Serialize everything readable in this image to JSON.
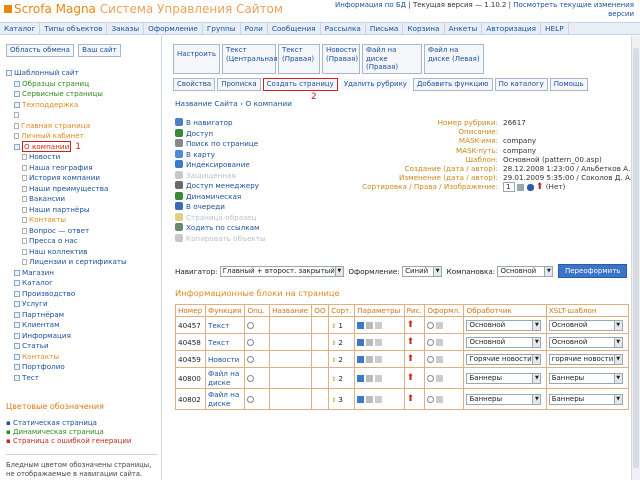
{
  "header": {
    "logo_main": "Scrofa Magna",
    "logo_sub": "Система Управления Сайтом",
    "info_link": "Информация по БД",
    "version_text": "| Текущая версия — 1.10.2 |",
    "changes_link": "Посмотреть текущие изменения версии"
  },
  "topmenu": [
    "Каталог",
    "Типы объектов",
    "Заказы",
    "Оформление",
    "Группы",
    "Роли",
    "Сообщения",
    "Рассылка",
    "Письма",
    "Корзина",
    "Анкеты",
    "Авторизация",
    "HELP"
  ],
  "left": {
    "buttons": [
      "Область обмена",
      "Ваш сайт"
    ],
    "tree": [
      {
        "label": "Шаблонный сайт",
        "color": "dark",
        "indent": 0,
        "icon": "folder"
      },
      {
        "label": "Образцы страниц",
        "color": "green",
        "indent": 1,
        "icon": "folder"
      },
      {
        "label": "Сервисные страницы",
        "color": "green",
        "indent": 1,
        "icon": "folder"
      },
      {
        "label": "Техподдержка",
        "color": "orange",
        "indent": 1,
        "icon": "folder"
      },
      {
        "label": "",
        "color": "gray",
        "indent": 1,
        "icon": "page"
      },
      {
        "label": "Главная страница",
        "color": "orange",
        "indent": 1,
        "icon": "page"
      },
      {
        "label": "Личный кабинет",
        "color": "orange",
        "indent": 1,
        "icon": "page"
      },
      {
        "label": "О компании",
        "color": "red",
        "indent": 1,
        "icon": "folder",
        "selected": true
      },
      {
        "label": "Новости",
        "color": "dark",
        "indent": 2,
        "icon": "page"
      },
      {
        "label": "Наша география",
        "color": "dark",
        "indent": 2,
        "icon": "page"
      },
      {
        "label": "История компании",
        "color": "dark",
        "indent": 2,
        "icon": "page"
      },
      {
        "label": "Наши преимущества",
        "color": "dark",
        "indent": 2,
        "icon": "page"
      },
      {
        "label": "Вакансии",
        "color": "dark",
        "indent": 2,
        "icon": "page"
      },
      {
        "label": "Наши партнёры",
        "color": "dark",
        "indent": 2,
        "icon": "page"
      },
      {
        "label": "Контакты",
        "color": "orange",
        "indent": 2,
        "icon": "page"
      },
      {
        "label": "Вопрос — ответ",
        "color": "dark",
        "indent": 2,
        "icon": "page"
      },
      {
        "label": "Пресса о нас",
        "color": "dark",
        "indent": 2,
        "icon": "page"
      },
      {
        "label": "Наш коллектив",
        "color": "dark",
        "indent": 2,
        "icon": "page"
      },
      {
        "label": "Лицензии и сертификаты",
        "color": "dark",
        "indent": 2,
        "icon": "page"
      },
      {
        "label": "",
        "color": "dark",
        "indent": 1,
        "icon": "none"
      },
      {
        "label": "Магазин",
        "color": "dark",
        "indent": 1,
        "icon": "folder"
      },
      {
        "label": "Каталог",
        "color": "dark",
        "indent": 1,
        "icon": "folder"
      },
      {
        "label": "Производство",
        "color": "dark",
        "indent": 1,
        "icon": "folder"
      },
      {
        "label": "Услуги",
        "color": "dark",
        "indent": 1,
        "icon": "folder"
      },
      {
        "label": "Партнёрам",
        "color": "dark",
        "indent": 1,
        "icon": "folder"
      },
      {
        "label": "Клиентам",
        "color": "dark",
        "indent": 1,
        "icon": "folder"
      },
      {
        "label": "Информация",
        "color": "dark",
        "indent": 1,
        "icon": "folder"
      },
      {
        "label": "Статьи",
        "color": "dark",
        "indent": 1,
        "icon": "folder"
      },
      {
        "label": "Контакты",
        "color": "orange",
        "indent": 1,
        "icon": "folder"
      },
      {
        "label": "Портфолио",
        "color": "dark",
        "indent": 1,
        "icon": "folder"
      },
      {
        "label": "Тест",
        "color": "dark",
        "indent": 1,
        "icon": "folder"
      }
    ],
    "annotation_1": "1",
    "legend": {
      "title": "Цветовые обозначения",
      "static": "Статическая страница",
      "dynamic": "Динамическая страница",
      "error": "Страница с ошибкой генерации",
      "note": "Бледным цветом обозначены страницы, не отображаемые в навигации сайта."
    }
  },
  "right": {
    "tabs1": [
      "Настроить",
      "Текст (Центральная)",
      "Текст (Правая)",
      "Новости (Правая)",
      "Файл на диске (Правая)",
      "Файл на диске (Левая)"
    ],
    "tabs2": [
      "Свойства",
      "Прописка",
      "Создать страницу",
      "Удалить рубрику",
      "Добавить функцию",
      "По каталогу",
      "Помощь"
    ],
    "annotation_2": "2",
    "breadcrumb": "Название Сайта › О компании",
    "actions": [
      {
        "label": "В навигатор",
        "color": "blue",
        "icon_color": "#4a7fc8"
      },
      {
        "label": "Доступ",
        "color": "blue",
        "icon_color": "#3a8a3a"
      },
      {
        "label": "Поиск по странице",
        "color": "blue",
        "icon_color": "#888"
      },
      {
        "label": "В карту",
        "color": "blue",
        "icon_color": "#4a8ad8"
      },
      {
        "label": "Индексирование",
        "color": "blue",
        "icon_color": "#3a7ac8"
      },
      {
        "label": "Защищенная",
        "color": "gray",
        "icon_color": "#c8c8c8"
      },
      {
        "label": "Доступ менеджеру",
        "color": "blue",
        "icon_color": "#6a6a6a"
      },
      {
        "label": "Динамическая",
        "color": "blue",
        "icon_color": "#3a8a3a"
      },
      {
        "label": "В очереди",
        "color": "blue",
        "icon_color": "#3a6ab8"
      },
      {
        "label": "Страница-образец",
        "color": "gray",
        "icon_color": "#e0d080"
      },
      {
        "label": "Ходить по ссылкам",
        "color": "blue",
        "icon_color": "#6a8a6a"
      },
      {
        "label": "Копировать объекты",
        "color": "gray",
        "icon_color": "#c8c8c8"
      }
    ],
    "props": [
      {
        "k": "Номер рубрики:",
        "v": "26617"
      },
      {
        "k": "Описание:",
        "v": ""
      },
      {
        "k": "MASK-имя:",
        "v": "company"
      },
      {
        "k": "MASK-путь:",
        "v": "company"
      },
      {
        "k": "Шаблон:",
        "v": "Основной (pattern_00.asp)"
      },
      {
        "k": "Создание (дата / автор):",
        "v": "28.12.2008 1:23:00 / Альбетков А. В."
      },
      {
        "k": "Изменение (дата / автор):",
        "v": "29.01.2009 5:35:00 / Соколов Д. А."
      },
      {
        "k": "Сортировка / Права / Изображение:",
        "v": "1"
      }
    ],
    "props_no": "(Нет)",
    "navrow": {
      "nav_label": "Навигатор:",
      "nav_value": "Главный + второст. закрытый",
      "design_label": "Оформление:",
      "design_value": "Синий",
      "layout_label": "Компановка:",
      "layout_value": "Основной",
      "reformat_button": "Переоформить"
    },
    "info_title": "Информационные блоки на странице",
    "table_headers": [
      "Номер",
      "Функция",
      "Опц.",
      "Название",
      "ОО",
      "Сорт.",
      "Параметры",
      "Рис.",
      "Оформл.",
      "Обработчик",
      "XSLT-шаблон"
    ],
    "rows": [
      {
        "num": "40457",
        "func": "Текст",
        "sort": "1",
        "handler": "Основной",
        "xslt": "Основной"
      },
      {
        "num": "40458",
        "func": "Текст",
        "sort": "2",
        "handler": "Основной",
        "xslt": "Основной"
      },
      {
        "num": "40459",
        "func": "Новости",
        "sort": "2",
        "handler": "Горячие новости",
        "xslt": "горячие новости"
      },
      {
        "num": "40800",
        "func": "Файл на диске",
        "sort": "2",
        "handler": "Баннеры",
        "xslt": "Баннеры"
      },
      {
        "num": "40802",
        "func": "Файл на диске",
        "sort": "3",
        "handler": "Баннеры",
        "xslt": "Баннеры"
      }
    ]
  }
}
